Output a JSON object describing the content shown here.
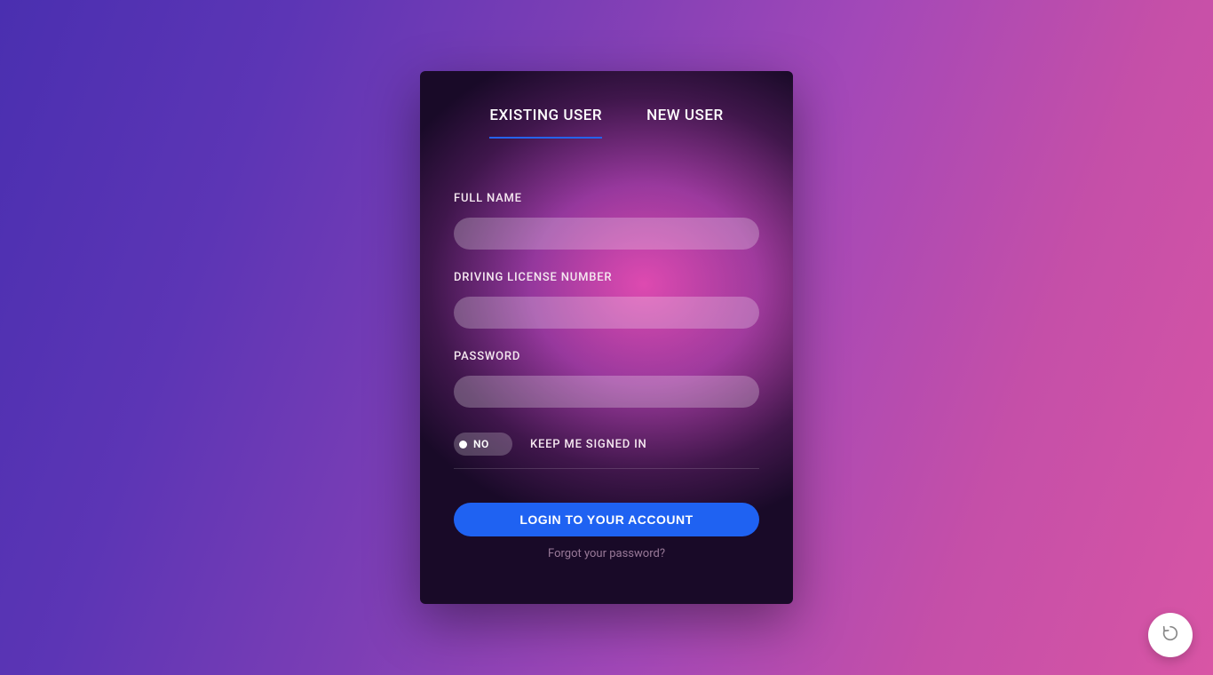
{
  "tabs": {
    "existing": "EXISTING USER",
    "new": "NEW USER"
  },
  "form": {
    "fullname_label": "FULL NAME",
    "fullname_value": "",
    "license_label": "DRIVING LICENSE NUMBER",
    "license_value": "",
    "password_label": "PASSWORD",
    "password_value": ""
  },
  "toggle": {
    "state_text": "NO",
    "label": "KEEP ME SIGNED IN"
  },
  "actions": {
    "login_button": "LOGIN TO YOUR ACCOUNT",
    "forgot_link": "Forgot your password?"
  }
}
